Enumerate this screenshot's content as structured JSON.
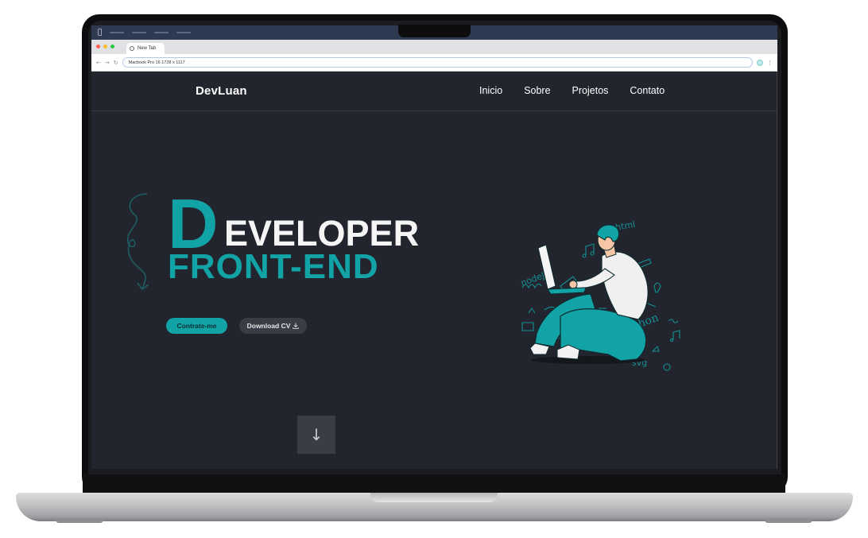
{
  "browser": {
    "tab_title": "New Tab",
    "address": "Macbook Pro 16  1728 x 1117"
  },
  "site": {
    "logo": "DevLuan",
    "nav": [
      "Inicio",
      "Sobre",
      "Projetos",
      "Contato"
    ],
    "hero": {
      "big_letter": "D",
      "title_rest": "EVELOPER",
      "subtitle": "FRONT-END"
    },
    "buttons": {
      "primary": "Contrate-me",
      "secondary": "Download CV"
    },
    "scroll_icon": "arrow-down-icon"
  },
  "colors": {
    "background": "#22252d",
    "accent": "#12a3a6",
    "button_dark": "#3a3d45"
  }
}
